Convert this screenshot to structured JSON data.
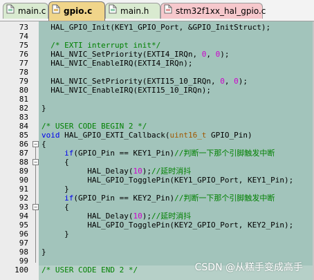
{
  "tabs": [
    {
      "label": "main.c"
    },
    {
      "label": "gpio.c"
    },
    {
      "label": "main.h"
    },
    {
      "label": "stm32f1xx_hal_gpio.c"
    }
  ],
  "lines": [
    {
      "num": "73",
      "segments": [
        {
          "t": "  HAL_GPIO_Init(KEY1_GPIO_Port, &GPIO_InitStruct);",
          "c": ""
        }
      ]
    },
    {
      "num": "74",
      "segments": []
    },
    {
      "num": "75",
      "segments": [
        {
          "t": "  /* EXTI interrupt init*/",
          "c": "cmt"
        }
      ]
    },
    {
      "num": "76",
      "segments": [
        {
          "t": "  HAL_NVIC_SetPriority(EXTI4_IRQn, ",
          "c": ""
        },
        {
          "t": "0",
          "c": "num"
        },
        {
          "t": ", ",
          "c": ""
        },
        {
          "t": "0",
          "c": "num"
        },
        {
          "t": ");",
          "c": ""
        }
      ]
    },
    {
      "num": "77",
      "segments": [
        {
          "t": "  HAL_NVIC_EnableIRQ(EXTI4_IRQn);",
          "c": ""
        }
      ]
    },
    {
      "num": "78",
      "segments": []
    },
    {
      "num": "79",
      "segments": [
        {
          "t": "  HAL_NVIC_SetPriority(EXTI15_10_IRQn, ",
          "c": ""
        },
        {
          "t": "0",
          "c": "num"
        },
        {
          "t": ", ",
          "c": ""
        },
        {
          "t": "0",
          "c": "num"
        },
        {
          "t": ");",
          "c": ""
        }
      ]
    },
    {
      "num": "80",
      "segments": [
        {
          "t": "  HAL_NVIC_EnableIRQ(EXTI15_10_IRQn);",
          "c": ""
        }
      ]
    },
    {
      "num": "81",
      "segments": []
    },
    {
      "num": "82",
      "segments": [
        {
          "t": "}",
          "c": ""
        }
      ]
    },
    {
      "num": "83",
      "segments": []
    },
    {
      "num": "84",
      "segments": [
        {
          "t": "/* USER CODE BEGIN 2 */",
          "c": "cmt"
        }
      ]
    },
    {
      "num": "85",
      "segments": [
        {
          "t": "void",
          "c": "kw"
        },
        {
          "t": " HAL_GPIO_EXTI_Callback(",
          "c": ""
        },
        {
          "t": "uint16_t",
          "c": "typ"
        },
        {
          "t": " GPIO_Pin)",
          "c": ""
        }
      ]
    },
    {
      "num": "86",
      "segments": [
        {
          "t": "{",
          "c": ""
        }
      ]
    },
    {
      "num": "87",
      "segments": [
        {
          "t": "     ",
          "c": ""
        },
        {
          "t": "if",
          "c": "kw"
        },
        {
          "t": "(GPIO_Pin == KEY1_Pin)",
          "c": ""
        },
        {
          "t": "//判断一下那个引脚触发中断",
          "c": "cmt"
        }
      ]
    },
    {
      "num": "88",
      "segments": [
        {
          "t": "     {",
          "c": ""
        }
      ]
    },
    {
      "num": "89",
      "segments": [
        {
          "t": "          HAL_Delay(",
          "c": ""
        },
        {
          "t": "10",
          "c": "num"
        },
        {
          "t": ");",
          "c": ""
        },
        {
          "t": "//延时消抖",
          "c": "cmt"
        }
      ]
    },
    {
      "num": "90",
      "segments": [
        {
          "t": "          HAL_GPIO_TogglePin(KEY1_GPIO_Port, KEY1_Pin);",
          "c": ""
        }
      ]
    },
    {
      "num": "91",
      "segments": [
        {
          "t": "     }",
          "c": ""
        }
      ]
    },
    {
      "num": "92",
      "segments": [
        {
          "t": "     ",
          "c": ""
        },
        {
          "t": "if",
          "c": "kw"
        },
        {
          "t": "(GPIO_Pin == KEY2_Pin)",
          "c": ""
        },
        {
          "t": "//判断一下那个引脚触发中断",
          "c": "cmt"
        }
      ]
    },
    {
      "num": "93",
      "segments": [
        {
          "t": "     {",
          "c": ""
        }
      ]
    },
    {
      "num": "94",
      "segments": [
        {
          "t": "          HAL_Delay(",
          "c": ""
        },
        {
          "t": "10",
          "c": "num"
        },
        {
          "t": ");",
          "c": ""
        },
        {
          "t": "//延时消抖",
          "c": "cmt"
        }
      ]
    },
    {
      "num": "95",
      "segments": [
        {
          "t": "          HAL_GPIO_TogglePin(KEY2_GPIO_Port, KEY2_Pin);",
          "c": ""
        }
      ]
    },
    {
      "num": "96",
      "segments": [
        {
          "t": "     }",
          "c": ""
        }
      ]
    },
    {
      "num": "97",
      "segments": []
    },
    {
      "num": "98",
      "segments": [
        {
          "t": "}",
          "c": ""
        }
      ]
    },
    {
      "num": "99",
      "segments": []
    },
    {
      "num": "100",
      "segments": [
        {
          "t": "/* USER CODE END 2 */",
          "c": "cmt"
        }
      ]
    }
  ],
  "watermark": "CSDN @从糕手变成高手",
  "colors": {
    "code_background": "#a2c4bb",
    "gutter_background": "#ececec",
    "keyword": "#0000ee",
    "number": "#cc00cc",
    "comment": "#008000",
    "type": "#a05800",
    "active_tab": "#f0d58a"
  },
  "icons": {
    "tab_file": "file-icon"
  }
}
